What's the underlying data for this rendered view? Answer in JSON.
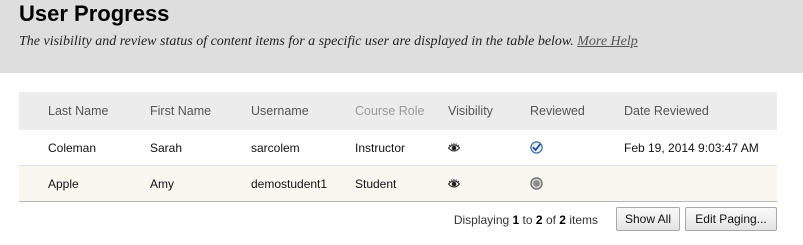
{
  "header": {
    "title": "User Progress",
    "description": "The visibility and review status of content items for a specific user are displayed in the table below.",
    "help_link": "More Help"
  },
  "table": {
    "columns": [
      "Last Name",
      "First Name",
      "Username",
      "Course Role",
      "Visibility",
      "Reviewed",
      "Date Reviewed"
    ],
    "rows": [
      {
        "last_name": "Coleman",
        "first_name": "Sarah",
        "username": "sarcolem",
        "course_role": "Instructor",
        "visibility_icon": "eye-icon",
        "reviewed_icon": "checkmark-reviewed-icon",
        "date_reviewed": "Feb 19, 2014 9:03:47 AM"
      },
      {
        "last_name": "Apple",
        "first_name": "Amy",
        "username": "demostudent1",
        "course_role": "Student",
        "visibility_icon": "eye-icon",
        "reviewed_icon": "not-reviewed-icon",
        "date_reviewed": ""
      }
    ]
  },
  "paging": {
    "prefix": "Displaying",
    "from": "1",
    "to_word": "to",
    "to": "2",
    "of_word": "of",
    "total": "2",
    "suffix": "items",
    "show_all": "Show All",
    "edit_paging": "Edit Paging..."
  },
  "colors": {
    "header_bg": "#dedede",
    "check_blue": "#2f6fb5"
  }
}
